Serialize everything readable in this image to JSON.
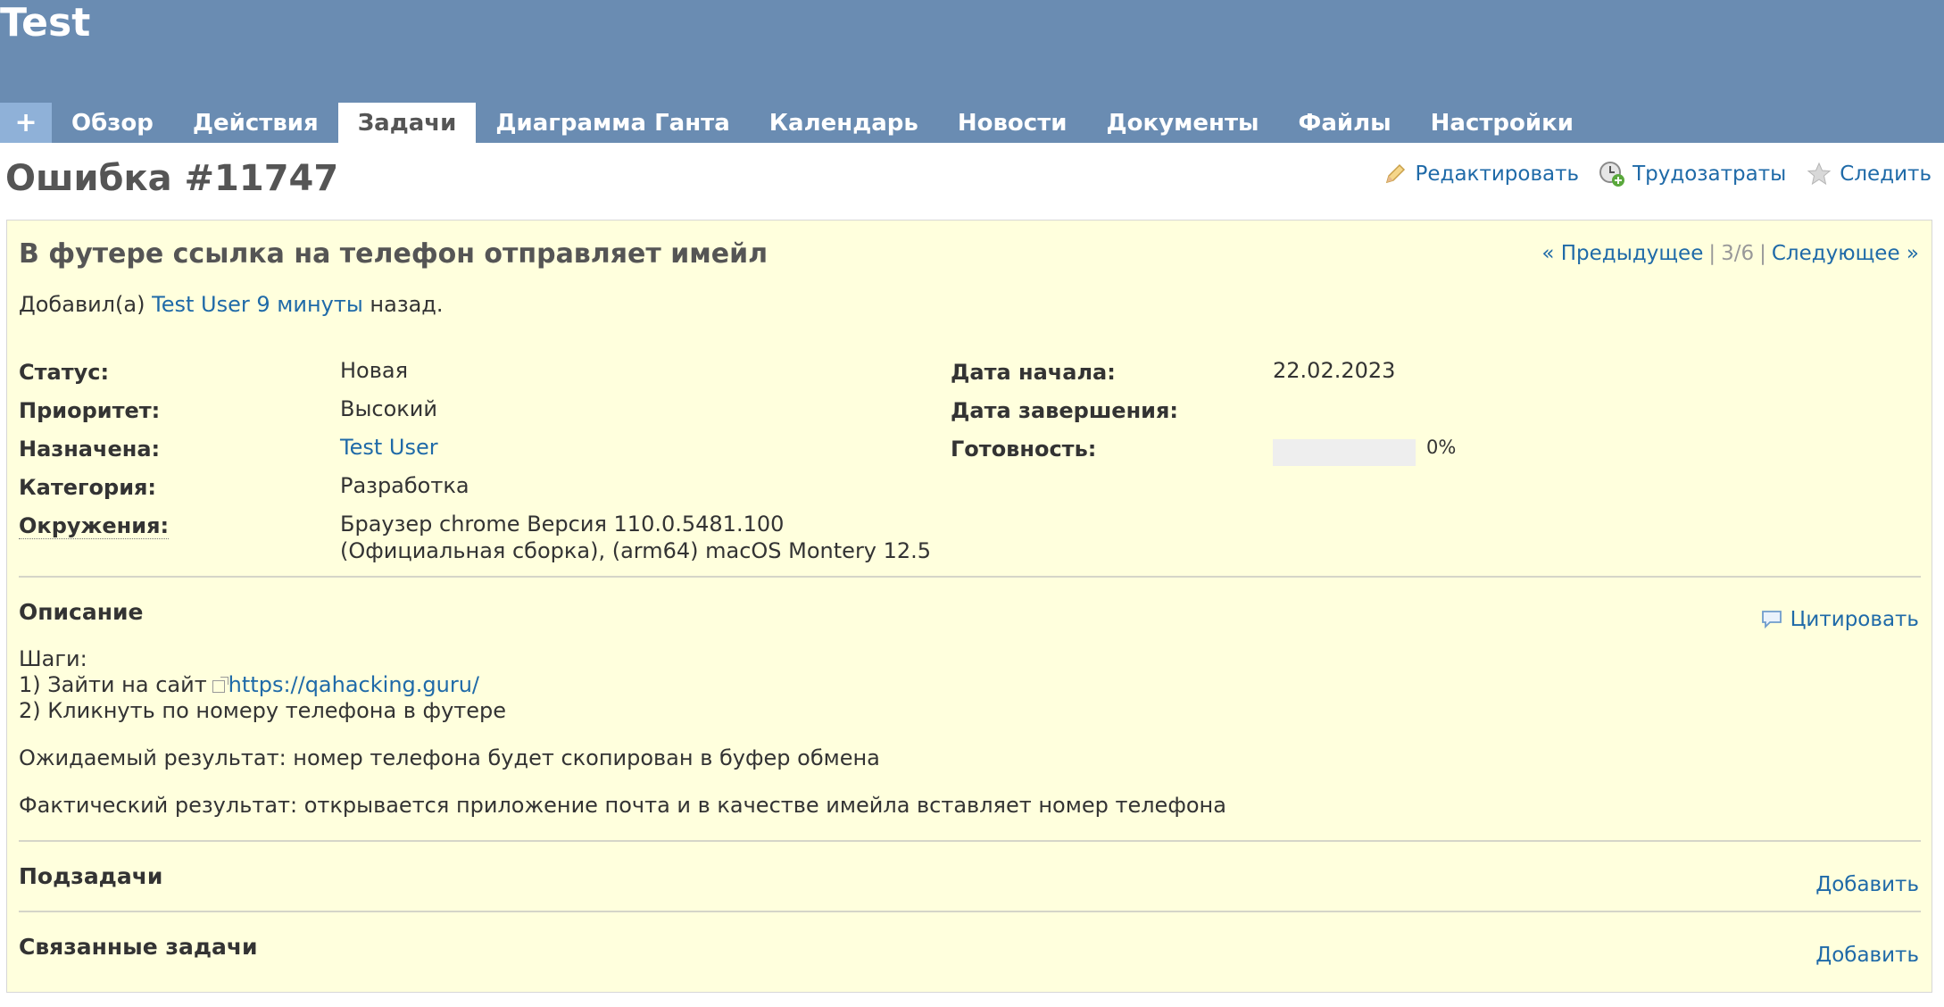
{
  "project": {
    "title": "Test"
  },
  "menu": {
    "new_label": "+",
    "tabs": [
      "Обзор",
      "Действия",
      "Задачи",
      "Диаграмма Ганта",
      "Календарь",
      "Новости",
      "Документы",
      "Файлы",
      "Настройки"
    ],
    "selected": "Задачи"
  },
  "issue": {
    "heading": "Ошибка #11747",
    "subject": "В футере ссылка на телефон отправляет имейл",
    "author_prefix": "Добавил(а)",
    "author": "Test User",
    "age": "9 минуты",
    "author_suffix": "назад.",
    "nav": {
      "prev": "« Предыдущее",
      "position": "3/6",
      "next": "Следующее »"
    }
  },
  "actions": {
    "edit": "Редактировать",
    "time": "Трудозатраты",
    "watch": "Следить"
  },
  "attributes": {
    "status_label": "Статус:",
    "status": "Новая",
    "priority_label": "Приоритет:",
    "priority": "Высокий",
    "assigned_label": "Назначена:",
    "assigned": "Test User",
    "category_label": "Категория:",
    "category": "Разработка",
    "env_label": "Окружения:",
    "env_line1": "Браузер chrome Версия 110.0.5481.100",
    "env_line2": "(Официальная сборка), (arm64) macOS Montery 12.5",
    "start_label": "Дата начала:",
    "start": "22.02.2023",
    "due_label": "Дата завершения:",
    "due": "",
    "done_label": "Готовность:",
    "done_text": "0%",
    "done_ratio": 0
  },
  "description": {
    "title": "Описание",
    "quote": "Цитировать",
    "steps_title": "Шаги:",
    "step1_prefix": "1) Зайти на сайт",
    "step1_link": "https://qahacking.guru/",
    "step2": "2) Кликнуть по номеру телефона в футере",
    "expected": "Ожидаемый результат: номер телефона будет скопирован в буфер обмена",
    "actual": "Фактический результат: открывается приложение почта и в качестве имейла вставляет номер телефона"
  },
  "subtasks": {
    "title": "Подзадачи",
    "add": "Добавить"
  },
  "relations": {
    "title": "Связанные задачи",
    "add": "Добавить"
  },
  "colors": {
    "header": "#6a8cb2",
    "link": "#1f6aa8",
    "box": "#ffffdd"
  }
}
